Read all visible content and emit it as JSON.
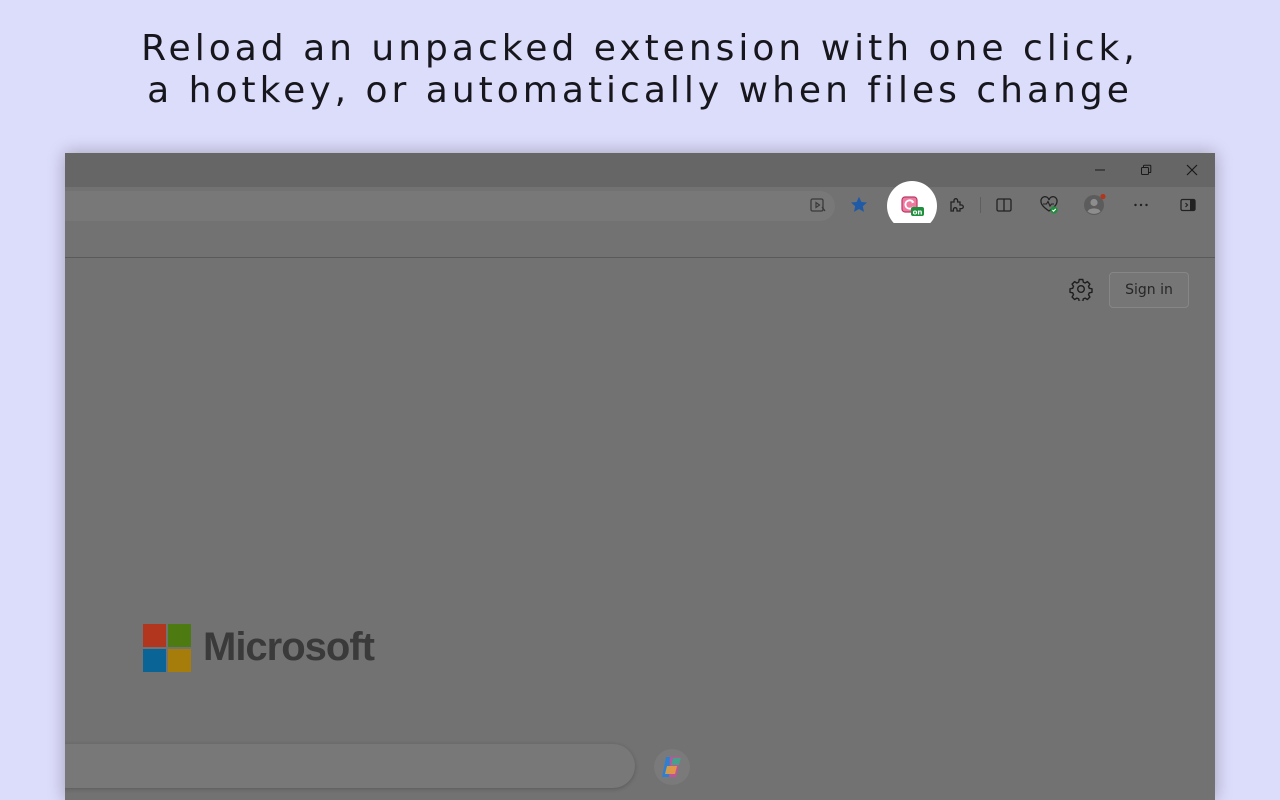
{
  "headline": {
    "line1": "Reload an unpacked extension with one click,",
    "line2": "a hotkey, or automatically when files change"
  },
  "window_controls": {
    "minimize_icon": "minimize-icon",
    "restore_icon": "restore-icon",
    "close_icon": "close-icon"
  },
  "toolbar": {
    "icons": [
      "read-aloud-icon",
      "favorite-star-icon",
      "extension-reloader-icon",
      "extensions-puzzle-icon",
      "split-screen-icon",
      "browser-essentials-icon",
      "profile-avatar-icon",
      "more-options-icon",
      "sidebar-toggle-icon"
    ],
    "extension_badge": "on"
  },
  "page": {
    "sign_in_label": "Sign in",
    "brand_name": "Microsoft"
  },
  "colors": {
    "background": "#dcdcfb",
    "ms_red": "#b2361d",
    "ms_green": "#4d7a11",
    "ms_blue": "#0a6496",
    "ms_yellow": "#a67c0a",
    "badge_green": "#1e8f3c",
    "star_blue": "#1f5aa6"
  }
}
